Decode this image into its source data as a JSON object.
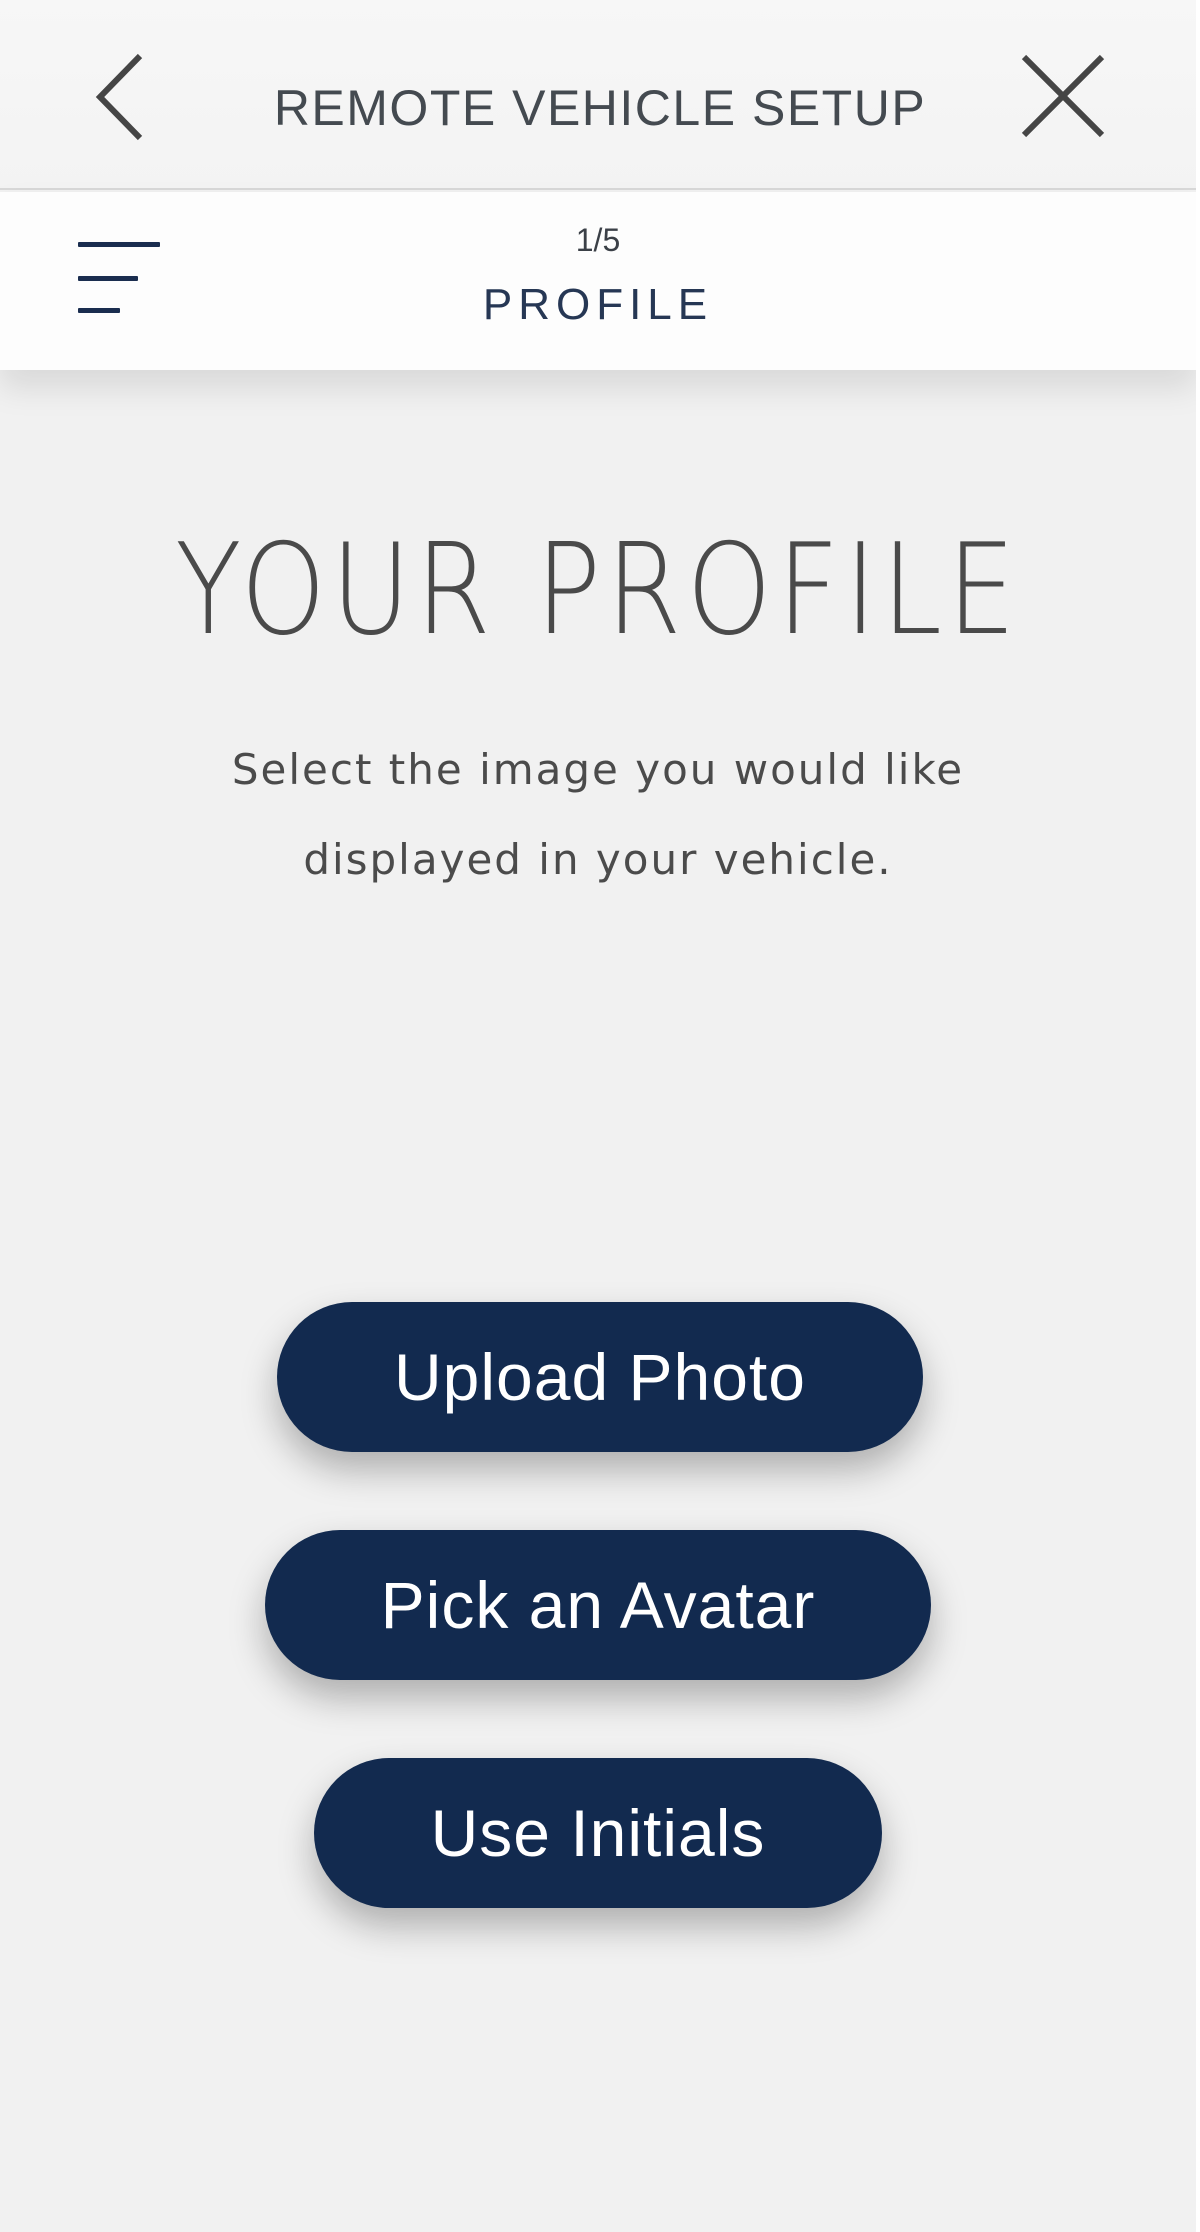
{
  "header": {
    "title": "REMOTE VEHICLE SETUP",
    "back_icon": "chevron-left-icon",
    "close_icon": "close-icon"
  },
  "stepper": {
    "menu_icon": "menu-icon",
    "step_counter": "1/5",
    "step_title": "PROFILE"
  },
  "content": {
    "heading": "YOUR PROFILE",
    "instruction_line1": "Select the image you would like",
    "instruction_line2": "displayed in your vehicle."
  },
  "actions": {
    "upload_photo": "Upload Photo",
    "pick_avatar": "Pick an Avatar",
    "use_initials": "Use Initials"
  },
  "colors": {
    "primary_button": "#122a4f",
    "background": "#f1f1f1",
    "header_text": "#444a50",
    "accent_navy": "#1a2d4f"
  }
}
